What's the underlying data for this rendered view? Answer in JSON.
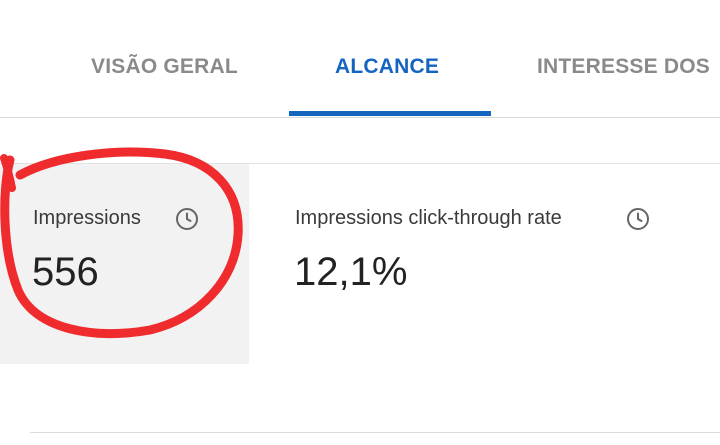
{
  "tabs": [
    {
      "label": "VISÃO GERAL",
      "active": false
    },
    {
      "label": "ALCANCE",
      "active": true
    },
    {
      "label": "INTERESSE DOS",
      "active": false
    }
  ],
  "colors": {
    "active_tab": "#1565c0",
    "inactive_tab": "#8a8a8a",
    "annotation": "#ef2b2d",
    "selected_card_bg": "#f2f2f2"
  },
  "metrics": [
    {
      "label": "Impressions",
      "value": "556",
      "icon": "clock-icon",
      "selected": true
    },
    {
      "label": "Impressions click-through rate",
      "value": "12,1%",
      "icon": "clock-icon",
      "selected": false
    }
  ]
}
